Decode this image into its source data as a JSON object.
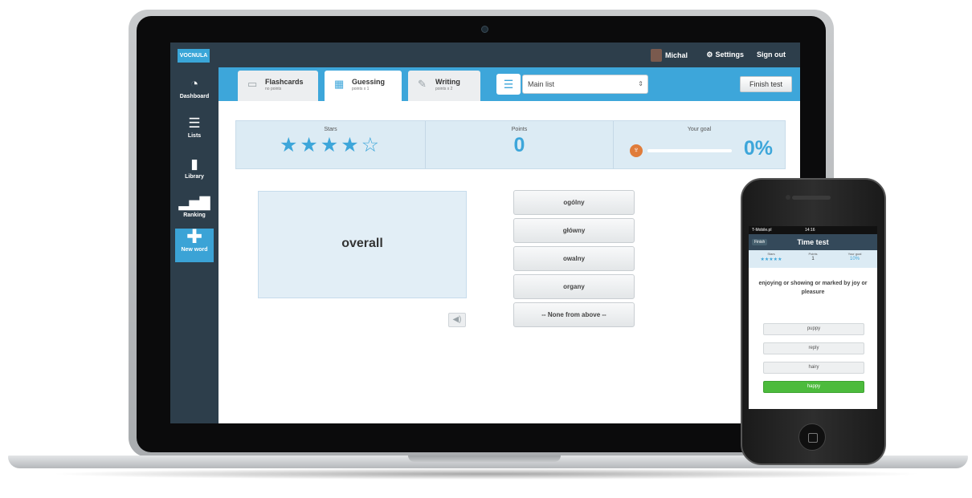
{
  "app": {
    "logo_text": "VOCNULA",
    "user_name": "Michal",
    "settings_label": "Settings",
    "signout_label": "Sign out"
  },
  "sidebar": {
    "items": [
      {
        "label": "Dashboard",
        "icon": "speedometer-icon"
      },
      {
        "label": "Lists",
        "icon": "list-icon"
      },
      {
        "label": "Library",
        "icon": "book-icon"
      },
      {
        "label": "Ranking",
        "icon": "bar-chart-icon"
      },
      {
        "label": "New word",
        "icon": "plus-icon"
      }
    ]
  },
  "tabs": [
    {
      "label": "Flashcards",
      "sub": "no points"
    },
    {
      "label": "Guessing",
      "sub": "points x 1"
    },
    {
      "label": "Writing",
      "sub": "points x 2"
    }
  ],
  "list_select": {
    "value": "Main list"
  },
  "finish_button": "Finish test",
  "stats": {
    "stars_label": "Stars",
    "stars_value": "★★★★☆",
    "stars_count": 4,
    "stars_max": 5,
    "points_label": "Points",
    "points_value": "0",
    "goal_label": "Your goal",
    "goal_value": "0%",
    "goal_fraction": 0
  },
  "card": {
    "word": "overall"
  },
  "answers": [
    "ogólny",
    "główny",
    "owalny",
    "organy",
    "-- None from above --"
  ],
  "phone": {
    "status_carrier": "T-Mobile.pl",
    "status_time": "14:16",
    "finish_label": "Finish",
    "title": "Time test",
    "stars_label": "Stars",
    "stars_value": "★★★★★",
    "points_label": "Points",
    "points_value": "1",
    "goal_label": "Your goal",
    "goal_value": "10%",
    "question": "enjoying or showing or marked by joy or pleasure",
    "answers": [
      "puppy",
      "reply",
      "hairy",
      "happy"
    ]
  },
  "colors": {
    "accent": "#3da6da",
    "sidebar": "#2d3e4b",
    "correct": "#4cbb3c"
  }
}
